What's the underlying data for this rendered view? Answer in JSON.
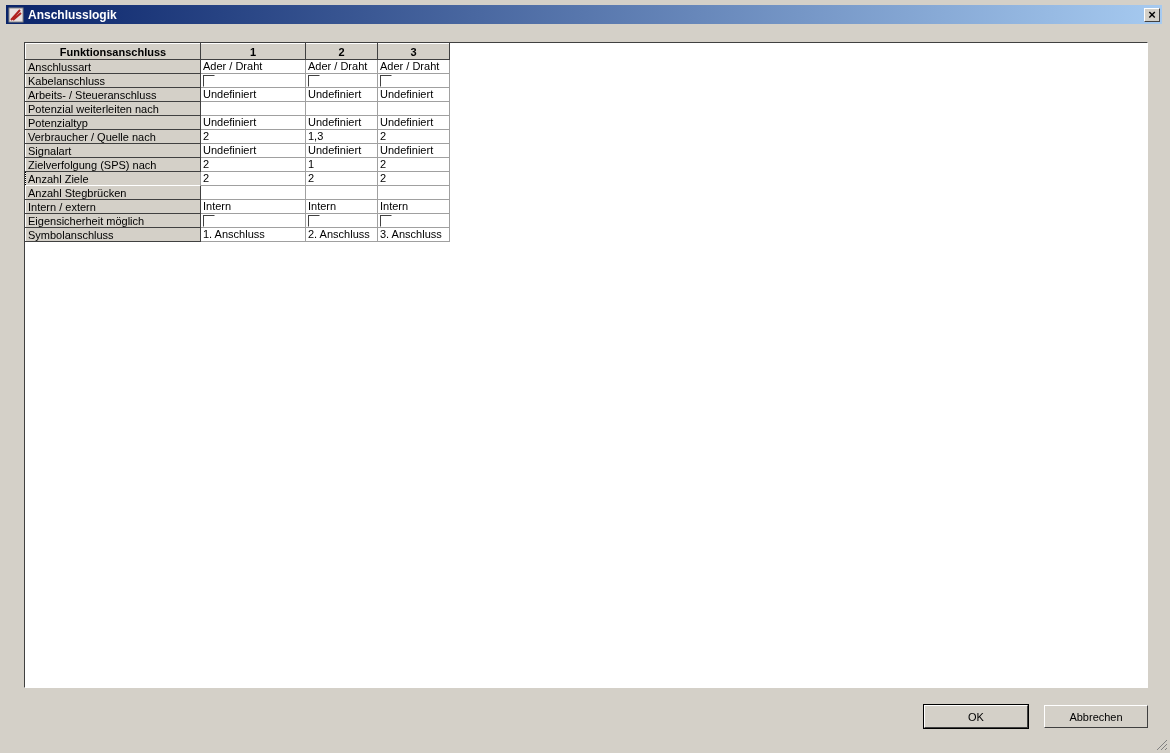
{
  "window": {
    "title": "Anschlusslogik",
    "close": "×"
  },
  "table": {
    "columns": [
      "Funktionsanschluss",
      "1",
      "2",
      "3"
    ],
    "rows": [
      {
        "kind": "text",
        "focused": false,
        "cells": [
          "Anschlussart",
          "Ader / Draht",
          "Ader / Draht",
          "Ader / Draht"
        ]
      },
      {
        "kind": "checkbox",
        "focused": false,
        "cells": [
          "Kabelanschluss",
          {
            "checked": false
          },
          {
            "checked": false
          },
          {
            "checked": false
          }
        ]
      },
      {
        "kind": "text",
        "focused": false,
        "cells": [
          "Arbeits- / Steueranschluss",
          "Undefiniert",
          "Undefiniert",
          "Undefiniert"
        ]
      },
      {
        "kind": "text",
        "focused": false,
        "cells": [
          "Potenzial weiterleiten nach",
          "",
          "",
          ""
        ]
      },
      {
        "kind": "text",
        "focused": false,
        "cells": [
          "Potenzialtyp",
          "Undefiniert",
          "Undefiniert",
          "Undefiniert"
        ]
      },
      {
        "kind": "text",
        "focused": false,
        "cells": [
          "Verbraucher / Quelle nach",
          "2",
          "1,3",
          "2"
        ]
      },
      {
        "kind": "text",
        "focused": false,
        "cells": [
          "Signalart",
          "Undefiniert",
          "Undefiniert",
          "Undefiniert"
        ]
      },
      {
        "kind": "text",
        "focused": false,
        "cells": [
          "Zielverfolgung (SPS) nach",
          "2",
          "1",
          "2"
        ]
      },
      {
        "kind": "text",
        "focused": true,
        "cells": [
          "Anzahl Ziele",
          "2",
          "2",
          "2"
        ]
      },
      {
        "kind": "text",
        "focused": false,
        "cells": [
          "Anzahl Stegbrücken",
          "",
          "",
          ""
        ]
      },
      {
        "kind": "text",
        "focused": false,
        "cells": [
          "Intern / extern",
          "Intern",
          "Intern",
          "Intern"
        ]
      },
      {
        "kind": "checkbox",
        "focused": false,
        "cells": [
          "Eigensicherheit möglich",
          {
            "checked": false
          },
          {
            "checked": false
          },
          {
            "checked": false
          }
        ]
      },
      {
        "kind": "text",
        "focused": false,
        "cells": [
          "Symbolanschluss",
          "1. Anschluss",
          "2. Anschluss",
          "3. Anschluss"
        ]
      }
    ]
  },
  "buttons": [
    {
      "label": "OK",
      "default": true
    },
    {
      "label": "Abbrechen",
      "default": false
    }
  ]
}
